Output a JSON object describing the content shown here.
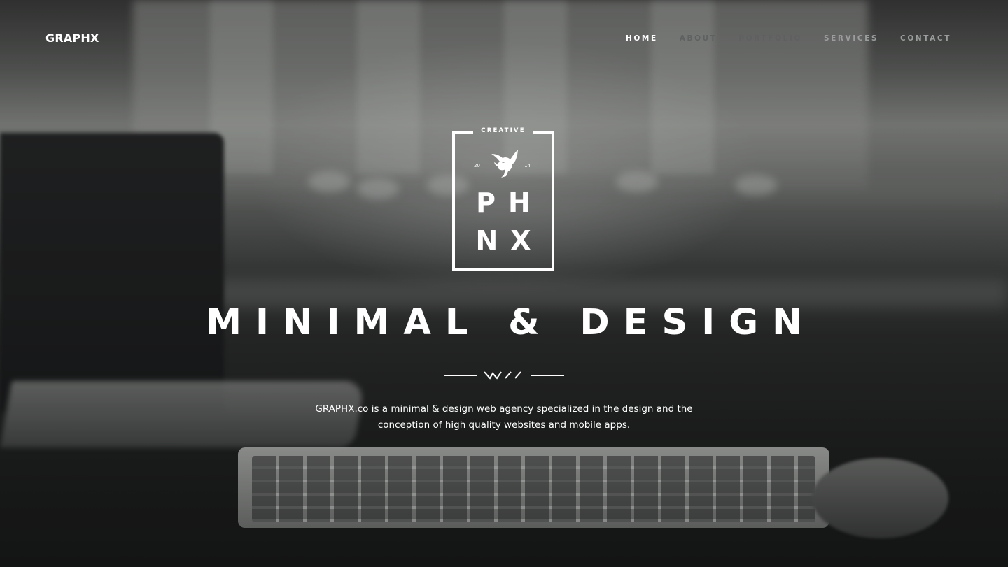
{
  "header": {
    "logo": "GRAPHX"
  },
  "nav": {
    "items": [
      {
        "label": "HOME",
        "state": "active"
      },
      {
        "label": "ABOUT",
        "state": "dim"
      },
      {
        "label": "PORTFOLIO",
        "state": "dim"
      },
      {
        "label": "SERVICES",
        "state": "mid"
      },
      {
        "label": "CONTACT",
        "state": "mid"
      }
    ]
  },
  "emblem": {
    "top_text": "CREATIVE",
    "year_left": "20",
    "year_right": "14",
    "line1": "PH",
    "line2": "NX",
    "icon": "phoenix-bird-icon"
  },
  "hero": {
    "headline": "MINIMAL & DESIGN",
    "description_line1": "GRAPHX.co is a minimal & design web agency specialized in the design and the",
    "description_line2": "conception of high quality websites and mobile apps."
  },
  "colors": {
    "text": "#ffffff",
    "nav_dim": "#5e6062",
    "nav_mid": "#9a9c9d",
    "background": "#1c1d1e"
  }
}
